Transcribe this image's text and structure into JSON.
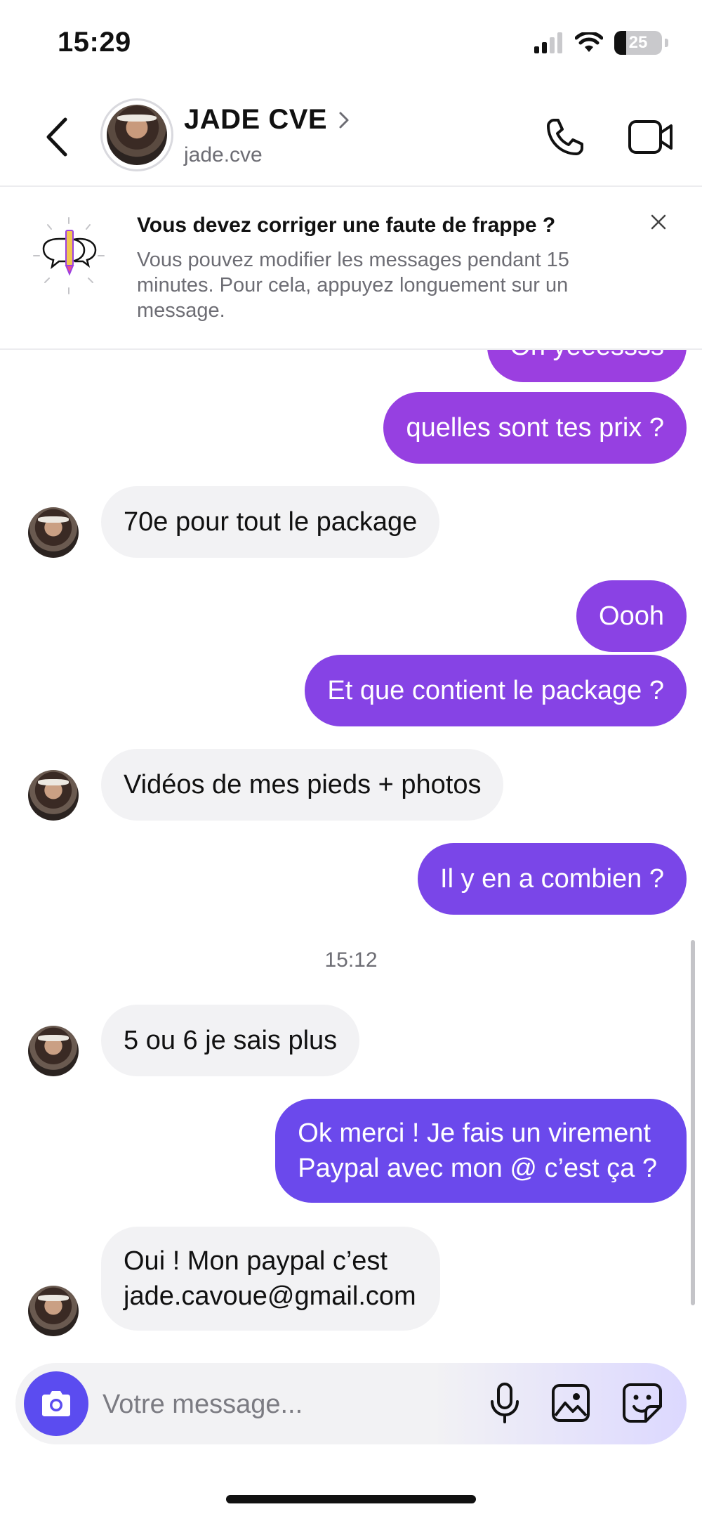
{
  "status_bar": {
    "time": "15:29",
    "battery": "25",
    "battery_level": 0.25
  },
  "header": {
    "name": "JADE CVE",
    "handle": "jade.cve",
    "chevron": "chevron-right-icon",
    "back_icon": "chevron-left-icon",
    "call_icon": "phone-icon",
    "video_icon": "video-camera-icon"
  },
  "tip": {
    "title": "Vous devez corriger une faute de frappe ?",
    "body": "Vous pouvez modifier les messages pendant 15 minutes. Pour cela, appuyez longuement sur un message.",
    "close_icon": "close-icon"
  },
  "messages": [
    {
      "dir": "out",
      "text": "Oh yeeessss"
    },
    {
      "dir": "out",
      "text": "quelles sont tes prix ?"
    },
    {
      "dir": "in",
      "text": "70e pour tout le package"
    },
    {
      "dir": "out",
      "text": "Oooh"
    },
    {
      "dir": "out",
      "text": "Et que contient le package ?"
    },
    {
      "dir": "in",
      "text": "Vidéos de mes pieds + photos"
    },
    {
      "dir": "out",
      "text": "Il y en a combien ?"
    },
    {
      "dir": "timestamp",
      "text": "15:12"
    },
    {
      "dir": "in",
      "text": "5 ou 6 je sais plus"
    },
    {
      "dir": "out",
      "text": "Ok merci ! Je fais un virement\nPaypal avec mon @ c’est ça ?"
    },
    {
      "dir": "in",
      "text": "Oui ! Mon paypal c’est\njade.cavoue@gmail.com"
    }
  ],
  "composer": {
    "placeholder": "Votre message...",
    "camera_icon": "camera-icon",
    "mic_icon": "microphone-icon",
    "gallery_icon": "image-icon",
    "sticker_icon": "sticker-icon"
  },
  "colors": {
    "bubble_out_top": "#9b3fe0",
    "bubble_out_bottom": "#5b4cf0",
    "bubble_in": "#f2f2f4",
    "accent": "#5b4cf0"
  }
}
